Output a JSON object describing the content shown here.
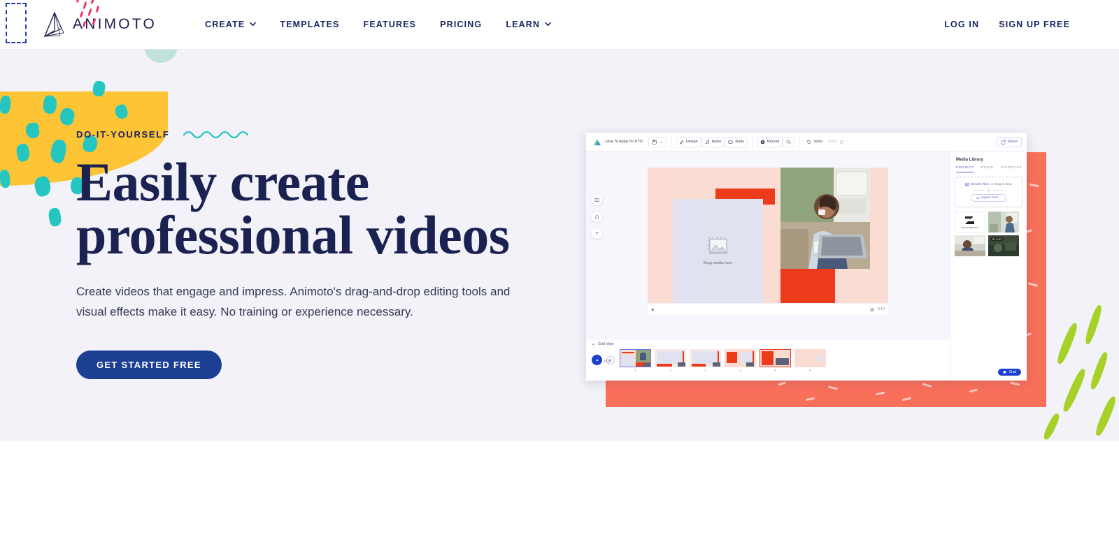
{
  "nav": {
    "brand": {
      "name": "ANIMOTO",
      "logo_icon": "animoto-logo-icon"
    },
    "links": [
      {
        "label": "CREATE",
        "has_caret": true
      },
      {
        "label": "TEMPLATES",
        "has_caret": false
      },
      {
        "label": "FEATURES",
        "has_caret": false
      },
      {
        "label": "PRICING",
        "has_caret": false
      },
      {
        "label": "LEARN",
        "has_caret": true
      }
    ],
    "login_label": "LOG IN",
    "signup_label": "SIGN UP FREE"
  },
  "hero": {
    "eyebrow": "DO-IT-YOURSELF",
    "headline_line1": "Easily create",
    "headline_line2": "professional videos",
    "subcopy": "Create videos that engage and impress. Animoto's drag-and-drop editing tools and visual effects make it easy. No training or experience necessary.",
    "cta_label": "GET STARTED FREE"
  },
  "app": {
    "toolbar": {
      "project_title": "How To Apply for PTO",
      "save_icon": "save-icon",
      "caret_icon": "chevron-down-icon",
      "buttons": [
        {
          "label": "Design",
          "icon": "pen-icon"
        },
        {
          "label": "Audio",
          "icon": "music-note-icon"
        },
        {
          "label": "Ratio",
          "icon": "aspect-ratio-icon"
        },
        {
          "label": "Record",
          "icon": "record-icon"
        }
      ],
      "search_icon": "search-icon",
      "undo_label": "Undo",
      "redo_label": "Redo",
      "share_label": "Share"
    },
    "canvas": {
      "side_tools": [
        {
          "name": "layout-tool",
          "glyph": "layout-icon"
        },
        {
          "name": "color-tool",
          "glyph": "droplet-icon"
        },
        {
          "name": "text-tool",
          "glyph": "text-icon"
        }
      ],
      "placeholder_label": "Drag media here",
      "placeholder_icon": "image-placeholder-icon",
      "player_time": "0:10",
      "scissors_icon": "trim-icon",
      "play_cursor_icon": "playhead-icon"
    },
    "gridview": {
      "label": "Grid View",
      "collapse_icon": "chevron-up-icon",
      "duration": "0:26",
      "play_icon": "play-icon",
      "add_label": "+",
      "slides": [
        {
          "num": "1",
          "selected": true
        },
        {
          "num": "2",
          "selected": false
        },
        {
          "num": "3",
          "selected": false
        },
        {
          "num": "4",
          "selected": false
        },
        {
          "num": "5",
          "selected": false
        },
        {
          "num": "6",
          "selected": false
        }
      ]
    },
    "library": {
      "title": "Media Library",
      "tabs": [
        {
          "label": "PROJECT",
          "active": true
        },
        {
          "label": "STOCK",
          "active": false
        },
        {
          "label": "FAVORITES",
          "active": false
        }
      ],
      "browse_link": "Browse files",
      "browse_rest": "or drag & drop",
      "or_label": "or",
      "import_label": "Import from...",
      "import_icon": "cloud-icon",
      "browse_icon": "image-icon",
      "items": [
        {
          "name": "zz-logo-thumb",
          "caption": "ZOHO DESIGNS",
          "duration": ""
        },
        {
          "name": "office-photo-thumb",
          "duration": ""
        },
        {
          "name": "desk-photo-thumb",
          "duration": ""
        },
        {
          "name": "video-thumb",
          "duration": "0:27"
        }
      ]
    },
    "chat_label": "Chat",
    "chat_icon": "chat-bubble-icon"
  },
  "colors": {
    "brand_navy": "#1b2150",
    "cta_blue": "#1c3f94",
    "accent_teal": "#26c6c0",
    "accent_yellow": "#fdc435",
    "accent_coral": "#f9705a",
    "accent_pink": "#ef2f61",
    "accent_green": "#a7d129",
    "hero_bg": "#f2f2f8",
    "app_purple": "#5b63d3"
  }
}
